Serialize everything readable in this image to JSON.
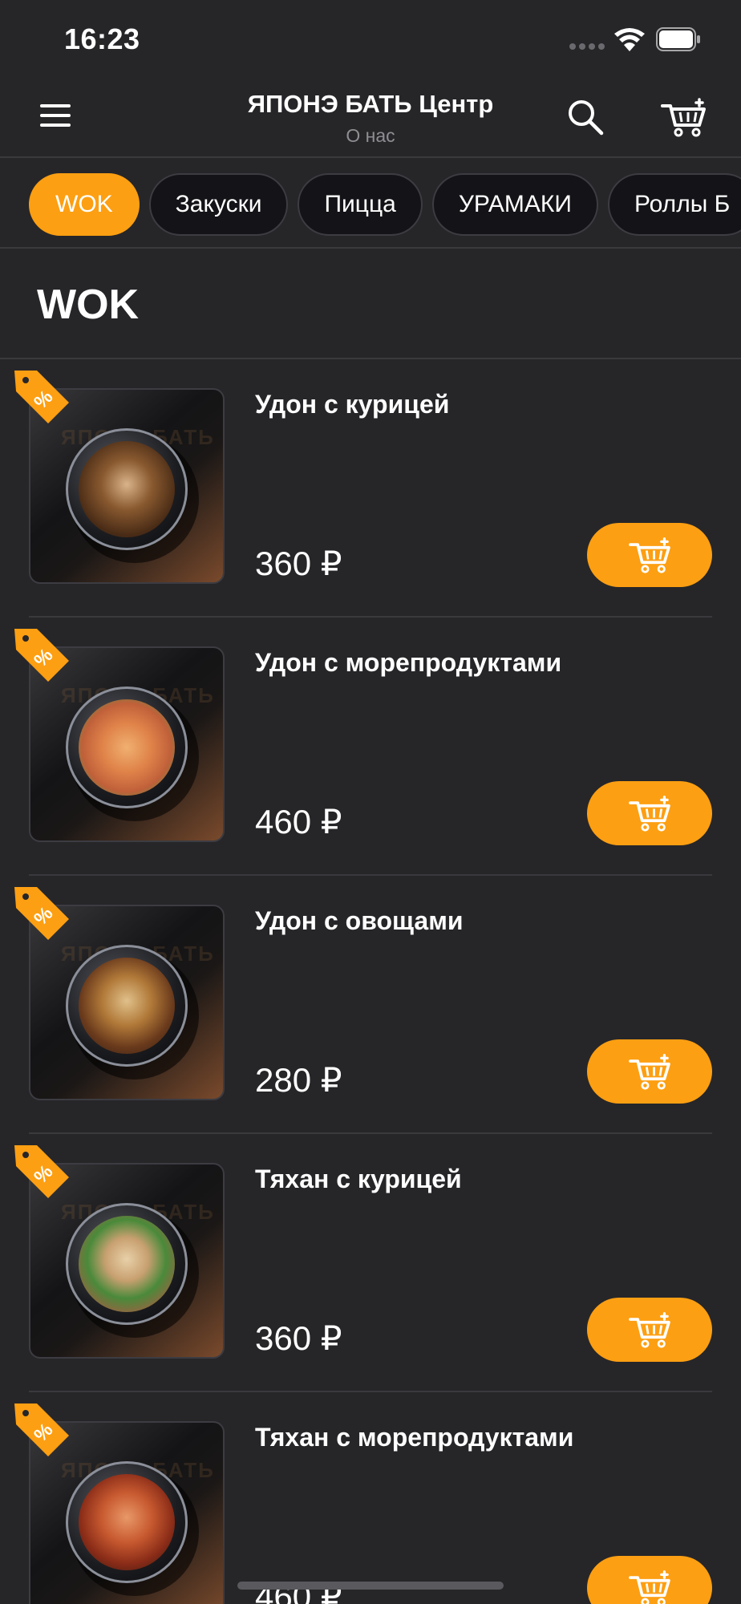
{
  "status_bar": {
    "time": "16:23"
  },
  "header": {
    "title": "ЯПОНЭ БАТЬ Центр",
    "subtitle": "О нас"
  },
  "categories": [
    "WOK",
    "Закуски",
    "Пицца",
    "УРАМАКИ",
    "Роллы Б"
  ],
  "active_category": "WOK",
  "section": {
    "title": "WOK"
  },
  "products": [
    {
      "name": "Удон с курицей",
      "price": "360 ₽"
    },
    {
      "name": "Удон с морепродуктами",
      "price": "460 ₽"
    },
    {
      "name": "Удон с овощами",
      "price": "280 ₽"
    },
    {
      "name": "Тяхан с курицей",
      "price": "360 ₽"
    },
    {
      "name": "Тяхан с морепродуктами",
      "price": "460 ₽"
    }
  ],
  "colors": {
    "accent": "#fd9f12",
    "background": "#262629",
    "chip_background": "#141418",
    "muted_text": "#8e8e93"
  },
  "icons": {
    "menu": "hamburger-menu-icon",
    "search": "search-icon",
    "cart": "shopping-cart-icon",
    "discount": "discount-tag-icon",
    "add_to_cart": "add-to-cart-icon"
  }
}
